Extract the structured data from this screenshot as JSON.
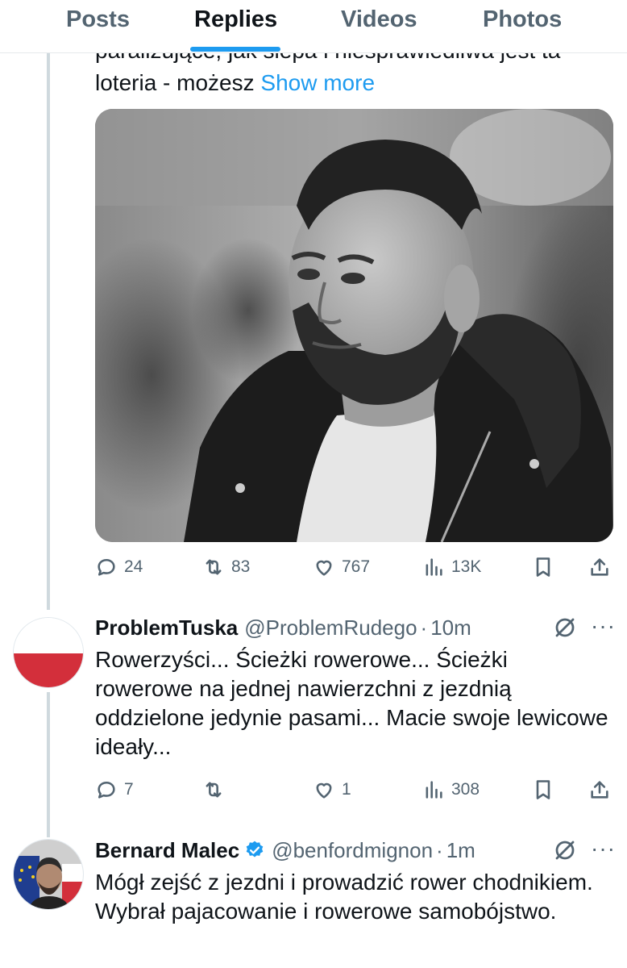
{
  "tabs": [
    {
      "label": "Posts"
    },
    {
      "label": "Replies"
    },
    {
      "label": "Videos"
    },
    {
      "label": "Photos"
    }
  ],
  "active_tab": "Replies",
  "first_tweet": {
    "text_line1": "paraliżujące, jak ślepa i niesprawiedliwa jest ta",
    "text_line2": "loteria - możesz",
    "show_more": "Show more",
    "stats": {
      "replies": "24",
      "reposts": "83",
      "likes": "767",
      "views": "13K"
    }
  },
  "replies": [
    {
      "name": "ProblemTuska",
      "handle": "@ProblemRudego",
      "time": "10m",
      "verified": false,
      "avatar": "polish-flag",
      "body": "Rowerzyści... Ścieżki rowerowe... Ścieżki rowerowe na jednej nawierzchni z jezdnią oddzielone jedynie pasami... Macie swoje lewicowe ideały...",
      "stats": {
        "replies": "7",
        "reposts": "",
        "likes": "1",
        "views": "308"
      }
    },
    {
      "name": "Bernard Malec",
      "handle": "@benfordmignon",
      "time": "1m",
      "verified": true,
      "avatar": "person-with-flags",
      "body": "Mógł zejść z jezdni i prowadzić rower chodnikiem. Wybrał pajacowanie i rowerowe samobójstwo."
    }
  ],
  "separator": "·",
  "more_glyph": "···",
  "colors": {
    "accent": "#1d9bf0",
    "secondary_text": "#536471",
    "primary_text": "#0f1419"
  },
  "icons": [
    "reply-icon",
    "repost-icon",
    "like-icon",
    "views-icon",
    "bookmark-icon",
    "share-icon",
    "grok-icon",
    "more-icon",
    "verified-icon"
  ]
}
